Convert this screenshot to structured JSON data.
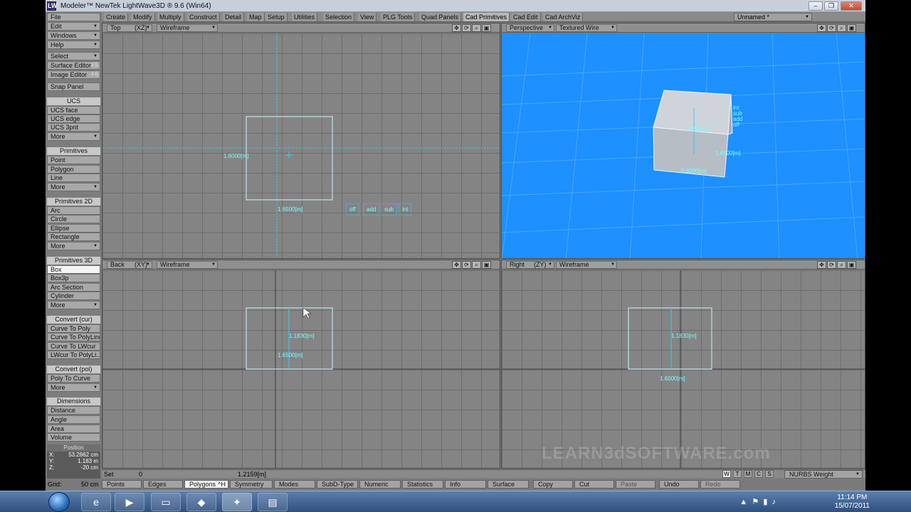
{
  "app": {
    "title": "Modeler™ NewTek LightWave3D ® 9.6  (Win64)",
    "logo": "LW",
    "minimize": "–",
    "restore": "❐",
    "close": "✕"
  },
  "left_top_menu": [
    "File",
    "Edit",
    "Windows",
    "Help"
  ],
  "top_tabs": [
    "Create",
    "Modify",
    "Multiply",
    "Construct",
    "Detail",
    "Map",
    "Setup",
    "Utilities",
    "Selection",
    "View",
    "PLG Tools",
    "Quad Panels",
    "Cad Primitives",
    "Cad Edit",
    "Cad ArchViz"
  ],
  "active_tab": "Cad Primitives",
  "scene_name": "Unnamed *",
  "left_panel": {
    "select": "Select",
    "surface_editor": "Surface Editor",
    "surface_editor_key": "F5",
    "image_editor": "Image Editor",
    "image_editor_key": "F6",
    "snap_panel": "Snap Panel",
    "ucs_header": "UCS",
    "ucs": [
      "UCS face",
      "UCS edge",
      "UCS 3pnt"
    ],
    "ucs_more": "More",
    "primitives_header": "Primitives",
    "primitives": [
      "Point",
      "Polygon",
      "Line"
    ],
    "primitives_more": "More",
    "primitives2d_header": "Primitives 2D",
    "primitives2d": [
      "Arc",
      "Circle",
      "Ellipse",
      "Rectangle"
    ],
    "primitives2d_more": "More",
    "primitives3d_header": "Primitives 3D",
    "primitives3d": [
      "Box",
      "Box3p",
      "Arc Section",
      "Cylinder"
    ],
    "primitives3d_more": "More",
    "convert_cur_header": "Convert (cur)",
    "convert_cur": [
      "Curve To Poly",
      "Curve To PolyLine",
      "Curve To LWcur",
      "LWcur To PolyLi..."
    ],
    "convert_pol_header": "Convert (pol)",
    "convert_pol": [
      "Poly To Curve"
    ],
    "convert_pol_more": "More",
    "dimensions_header": "Dimensions",
    "dimensions": [
      "Distance",
      "Angle",
      "Area",
      "Volume"
    ],
    "position": {
      "header": "Position",
      "x_label": "X:",
      "x": "53.2862 cm",
      "y_label": "Y:",
      "y": "1.183 m",
      "z_label": "Z:",
      "z": "-20 cm"
    }
  },
  "viewports": {
    "top": {
      "view": "Top",
      "axis": "(XZ)",
      "mode": "Wireframe",
      "dim_w": "1.6500[m]",
      "dim_h": "1.6000[m]",
      "ops": [
        "off",
        "add",
        "sub",
        "int"
      ]
    },
    "perspective": {
      "view": "Perspective",
      "mode": "Textured Wire",
      "dim_a": "1.1830[m]",
      "dim_b": "1.6500[m]",
      "dim_c": "1.6000[m]",
      "ops": [
        "int",
        "sub",
        "add",
        "off"
      ]
    },
    "back": {
      "view": "Back",
      "axis": "(XY)",
      "mode": "Wireframe",
      "dim_h": "1.1830[m]",
      "dim_w": "1.6500[m]"
    },
    "right": {
      "view": "Right",
      "axis": "(ZY)",
      "mode": "Wireframe",
      "dim_h": "1.1830[m]",
      "dim_w": "1.6000[m]"
    }
  },
  "status": {
    "set_label": "Set",
    "set_value": "0",
    "measure": "1.2159[m]",
    "wtmcs": [
      "W",
      "T",
      "M",
      "C",
      "S"
    ],
    "weight": "NURBS Weight"
  },
  "bottom": {
    "grid_label": "Grid:",
    "grid_value": "50 cm",
    "buttons": [
      "Points",
      "Edges",
      "Polygons",
      "Symmetry",
      "Modes",
      "SubD-Type",
      "Numeric",
      "Statistics",
      "Info",
      "Surface",
      "Copy",
      "Cut",
      "Paste",
      "Undo",
      "Redo"
    ],
    "polygons_key": "^H"
  },
  "watermark": "LEARN3dSOFTWARE.com",
  "taskbar": {
    "time": "11:14 PM",
    "date": "15/07/2011"
  }
}
